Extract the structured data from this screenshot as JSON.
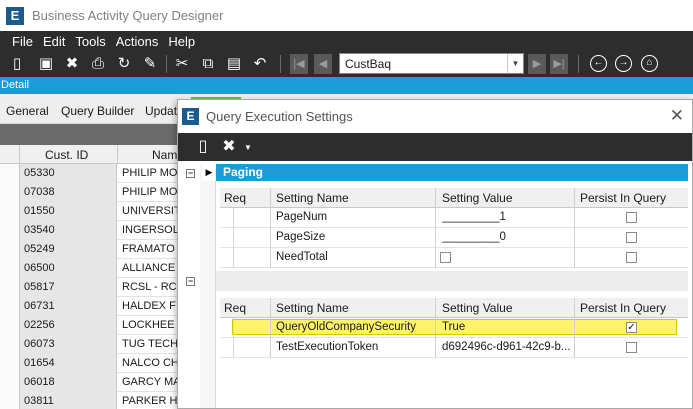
{
  "app": {
    "logo_letter": "E",
    "title": "Business Activity Query Designer"
  },
  "menu": [
    "File",
    "Edit",
    "Tools",
    "Actions",
    "Help"
  ],
  "toolbar": {
    "query_combo_value": "CustBaq",
    "icons": [
      "new-icon",
      "save-icon",
      "delete-icon",
      "print-icon",
      "refresh-icon",
      "clear-icon",
      "cut-icon",
      "copy-icon",
      "paste-icon",
      "undo-icon",
      "first-icon",
      "prev-icon",
      "next-icon",
      "last-icon",
      "back-icon",
      "forward-icon",
      "home-icon"
    ]
  },
  "detail_label": "Detail",
  "bg_tabs": [
    "General",
    "Query Builder",
    "Updat"
  ],
  "bg_grid": {
    "columns": [
      "Cust. ID",
      "Nam"
    ],
    "rows": [
      {
        "id": "05330",
        "name": "PHILIP MO"
      },
      {
        "id": "07038",
        "name": "PHILIP MO"
      },
      {
        "id": "01550",
        "name": "UNIVERSIT"
      },
      {
        "id": "03540",
        "name": "INGERSOL"
      },
      {
        "id": "05249",
        "name": "FRAMATO"
      },
      {
        "id": "06500",
        "name": "ALLIANCE"
      },
      {
        "id": "05817",
        "name": "RCSL - RC"
      },
      {
        "id": "06731",
        "name": "HALDEX F"
      },
      {
        "id": "02256",
        "name": "LOCKHEE"
      },
      {
        "id": "06073",
        "name": "TUG TECH"
      },
      {
        "id": "01654",
        "name": "NALCO CH"
      },
      {
        "id": "06018",
        "name": "GARCY MA"
      },
      {
        "id": "03811",
        "name": "PARKER H"
      }
    ]
  },
  "dialog": {
    "logo_letter": "E",
    "title": "Query Execution Settings",
    "close_glyph": "✕",
    "paging_label": "Paging",
    "columns": {
      "req": "Req",
      "setting_name": "Setting Name",
      "setting_value": "Setting Value",
      "persist": "Persist In Query"
    },
    "paging_rows": [
      {
        "name": "PageNum",
        "value": "_________1",
        "value_is_checkbox": false,
        "persist": false
      },
      {
        "name": "PageSize",
        "value": "_________0",
        "value_is_checkbox": false,
        "persist": false
      },
      {
        "name": "NeedTotal",
        "value": "",
        "value_is_checkbox": true,
        "value_checked": false,
        "persist": false
      }
    ],
    "other_rows": [
      {
        "name": "QueryOldCompanySecurity",
        "value": "True",
        "persist": true,
        "highlighted": true
      },
      {
        "name": "TestExecutionToken",
        "value": "d692496c-d961-42c9-b...",
        "persist": false,
        "highlighted": false
      }
    ]
  },
  "colors": {
    "toolbar_dark": "#2d2d2d",
    "accent_blue": "#1e9ad7",
    "highlight_yellow": "#fff36a",
    "brand_blue": "#1b5a8e"
  }
}
